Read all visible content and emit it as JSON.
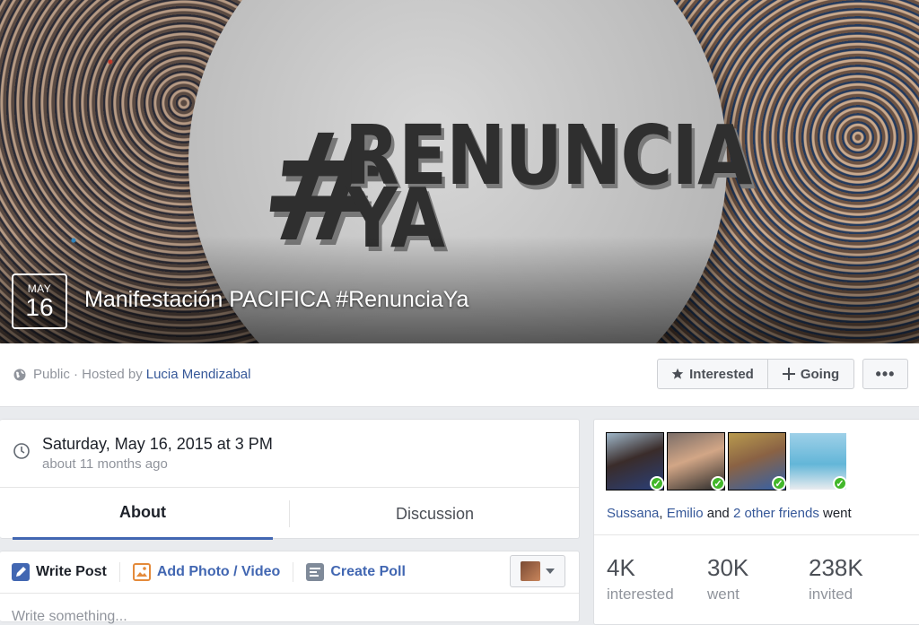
{
  "cover": {
    "hashtag_mark": "#",
    "headline_line1": "RENUNCIA",
    "headline_line2": "YA",
    "date_month": "MAY",
    "date_day": "16",
    "event_title": "Manifestación PACIFICA #RenunciaYa"
  },
  "action_bar": {
    "privacy_text": "Public · Hosted by",
    "host_name": "Lucia Mendizabal",
    "interested_label": "Interested",
    "going_label": "Going",
    "more_label": "•••",
    "globe_icon": "globe-icon",
    "star_icon": "star-icon",
    "plus_icon": "plus-icon"
  },
  "event_info": {
    "date_text": "Saturday, May 16, 2015 at 3 PM",
    "relative_time": "about 11 months ago",
    "clock_icon": "clock-icon"
  },
  "tabs": {
    "about": "About",
    "discussion": "Discussion",
    "active_color": "#4267b2"
  },
  "composer": {
    "write_post": "Write Post",
    "add_photo_video": "Add Photo / Video",
    "create_poll": "Create Poll",
    "placeholder": "Write something..."
  },
  "attendance": {
    "friend_1": "Sussana",
    "separator": ",",
    "friend_2": "Emilio",
    "and_text": "and",
    "others_link": "2 other friends",
    "went_text": "went",
    "stats": [
      {
        "value": "4K",
        "label": "interested"
      },
      {
        "value": "30K",
        "label": "went"
      },
      {
        "value": "238K",
        "label": "invited"
      }
    ],
    "check_color": "#42b72a"
  }
}
